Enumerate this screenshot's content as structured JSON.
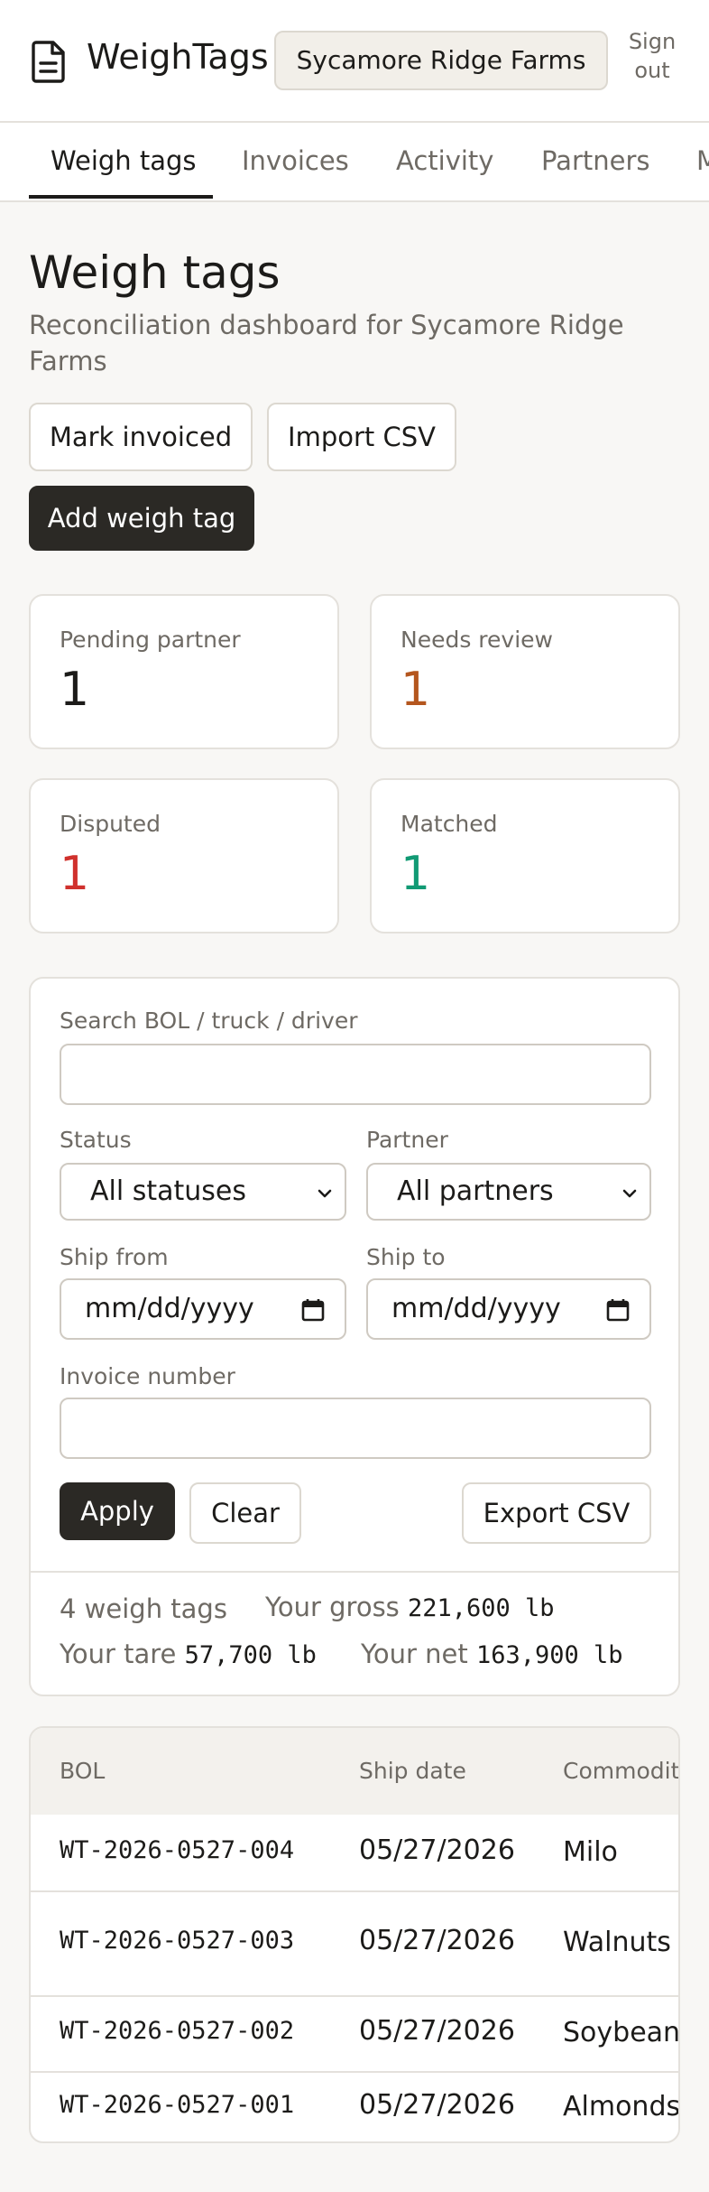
{
  "header": {
    "brand": "WeighTags",
    "organization": "Sycamore Ridge Farms",
    "sign_out": "Sign out"
  },
  "tabs": [
    {
      "label": "Weigh tags",
      "active": true
    },
    {
      "label": "Invoices",
      "active": false
    },
    {
      "label": "Activity",
      "active": false
    },
    {
      "label": "Partners",
      "active": false
    },
    {
      "label": "M",
      "active": false
    }
  ],
  "page": {
    "title": "Weigh tags",
    "subtitle": "Reconciliation dashboard for Sycamore Ridge Farms"
  },
  "actions": {
    "mark_invoiced": "Mark invoiced",
    "import_csv": "Import CSV",
    "add_weigh_tag": "Add weigh tag"
  },
  "stats": [
    {
      "label": "Pending partner",
      "value": "1",
      "color": "#1c1b19"
    },
    {
      "label": "Needs review",
      "value": "1",
      "color": "#b4561e"
    },
    {
      "label": "Disputed",
      "value": "1",
      "color": "#d0312d"
    },
    {
      "label": "Matched",
      "value": "1",
      "color": "#119a74"
    }
  ],
  "filters": {
    "search_label": "Search BOL / truck / driver",
    "search_value": "",
    "status_label": "Status",
    "status_value": "All statuses",
    "partner_label": "Partner",
    "partner_value": "All partners",
    "ship_from_label": "Ship from",
    "ship_from_value": "mm/dd/yyyy",
    "ship_to_label": "Ship to",
    "ship_to_value": "mm/dd/yyyy",
    "invoice_label": "Invoice number",
    "invoice_value": "",
    "apply": "Apply",
    "clear": "Clear",
    "export_csv": "Export CSV"
  },
  "summary": {
    "count": "4 weigh tags",
    "gross_label": "Your gross",
    "gross_value": "221,600 lb",
    "tare_label": "Your tare",
    "tare_value": "57,700 lb",
    "net_label": "Your net",
    "net_value": "163,900 lb"
  },
  "table": {
    "columns": [
      "BOL",
      "Ship date",
      "Commodity"
    ],
    "rows": [
      {
        "bol": "WT-2026-0527-004",
        "ship_date": "05/27/2026",
        "commodity": "Milo"
      },
      {
        "bol": "WT-2026-0527-003",
        "ship_date": "05/27/2026",
        "commodity": "Walnuts"
      },
      {
        "bol": "WT-2026-0527-002",
        "ship_date": "05/27/2026",
        "commodity": "Soybeans"
      },
      {
        "bol": "WT-2026-0527-001",
        "ship_date": "05/27/2026",
        "commodity": "Almonds"
      }
    ]
  }
}
